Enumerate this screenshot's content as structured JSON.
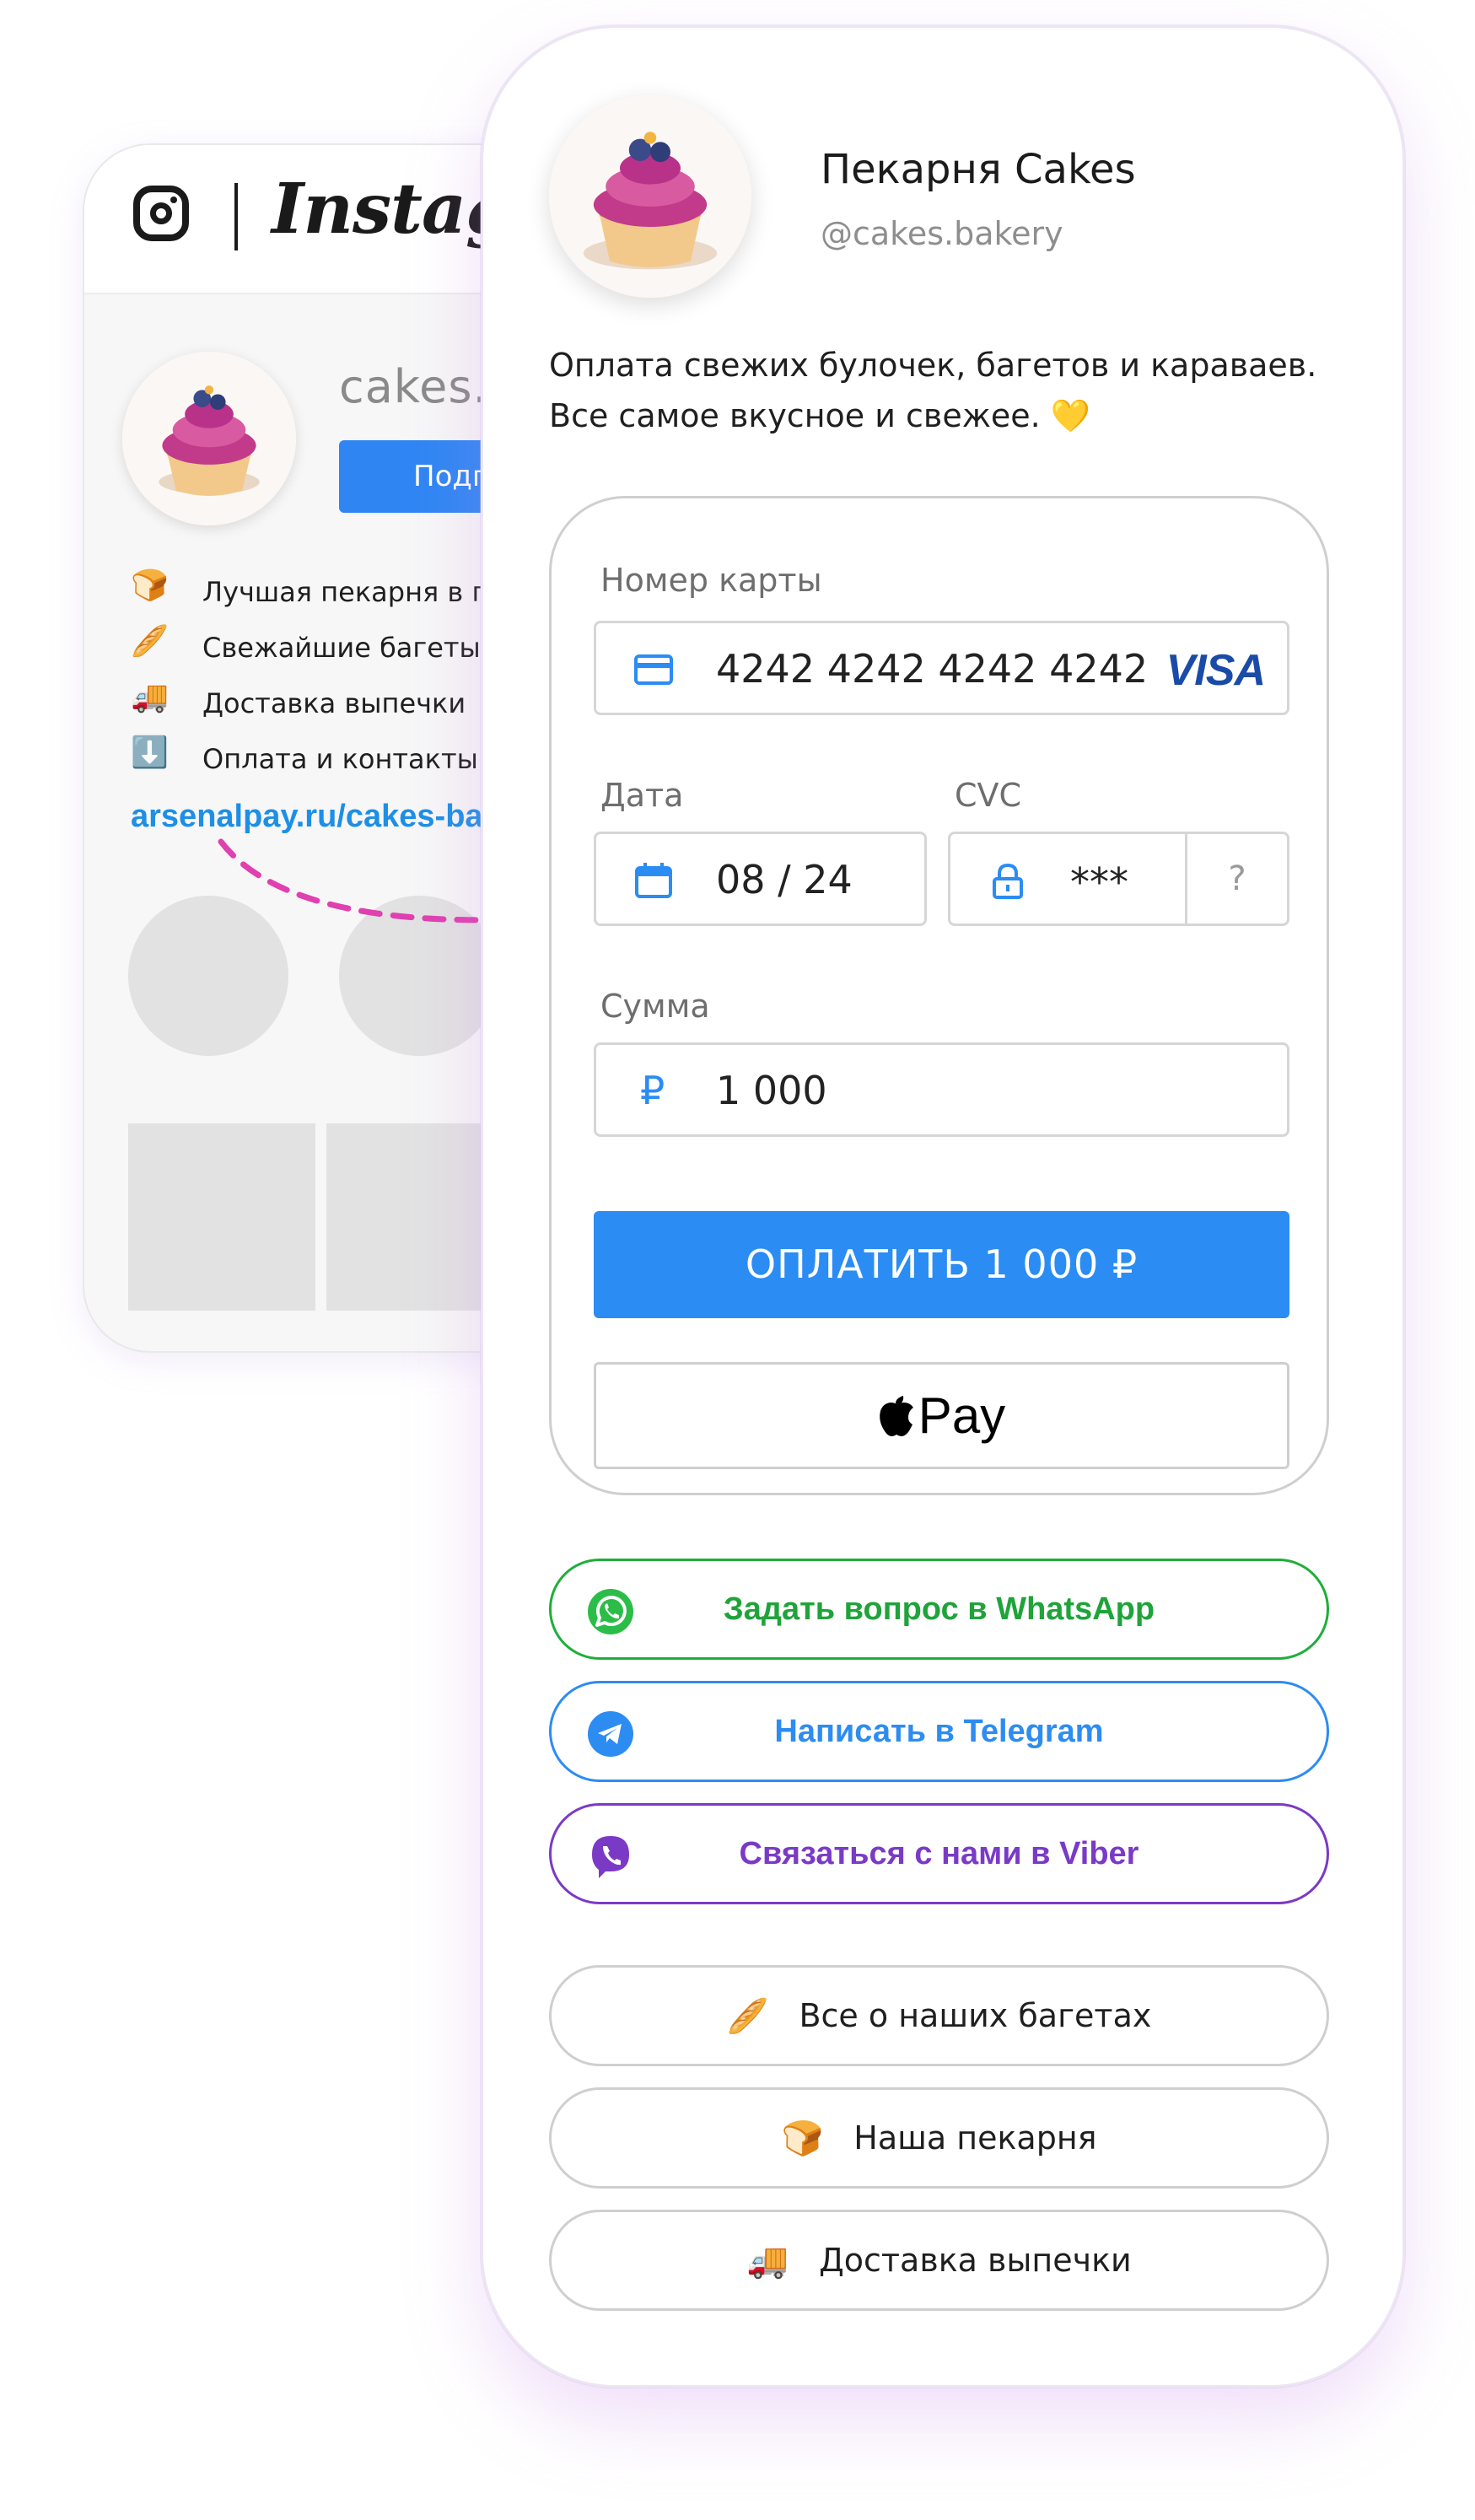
{
  "instagram": {
    "wordmark": "Instagram",
    "username": "cakes.b",
    "follow_button": "Подп",
    "bio": [
      {
        "emoji": "🍞",
        "text": "Лучшая пекарня в го"
      },
      {
        "emoji": "🥖",
        "text": "Свежайшие багеты"
      },
      {
        "emoji": "🚚",
        "text": "Доставка выпечки"
      },
      {
        "emoji": "⬇️",
        "text": "Оплата и контакты т"
      }
    ],
    "link": "arsenalpay.ru/cakes-ba"
  },
  "profile": {
    "name": "Пекарня Cakes",
    "handle": "@cakes.bakery",
    "description_line1": "Оплата свежих булочек, багетов и караваев.",
    "description_line2": "Все самое вкусное и свежее. 💛"
  },
  "payment": {
    "card_label": "Номер карты",
    "card_number": "4242 4242 4242 4242",
    "card_brand": "VISA",
    "date_label": "Дата",
    "date_value": "08 / 24",
    "cvc_label": "CVC",
    "cvc_value": "***",
    "cvc_help": "?",
    "amount_label": "Сумма",
    "currency_symbol": "₽",
    "amount_value": "1 000",
    "pay_button": "ОПЛАТИТЬ 1 000 ₽",
    "apple_pay_label": "Pay"
  },
  "messengers": [
    {
      "label": "Задать вопрос в WhatsApp",
      "icon": "whatsapp-icon",
      "color": "#1fa33a"
    },
    {
      "label": "Написать в Telegram",
      "icon": "telegram-icon",
      "color": "#2d8cf2"
    },
    {
      "label": "Связаться с нами в Viber",
      "icon": "viber-icon",
      "color": "#7b3ac6"
    }
  ],
  "links": [
    {
      "emoji": "🥖",
      "label": "Все о наших багетах"
    },
    {
      "emoji": "🍞",
      "label": "Наша пекарня"
    },
    {
      "emoji": "🚚",
      "label": "Доставка выпечки"
    }
  ],
  "colors": {
    "accent": "#2b8cf4",
    "card_brand": "#1a4ba8",
    "ig_link": "#1d8fe6",
    "arrow": "#e040b0"
  }
}
